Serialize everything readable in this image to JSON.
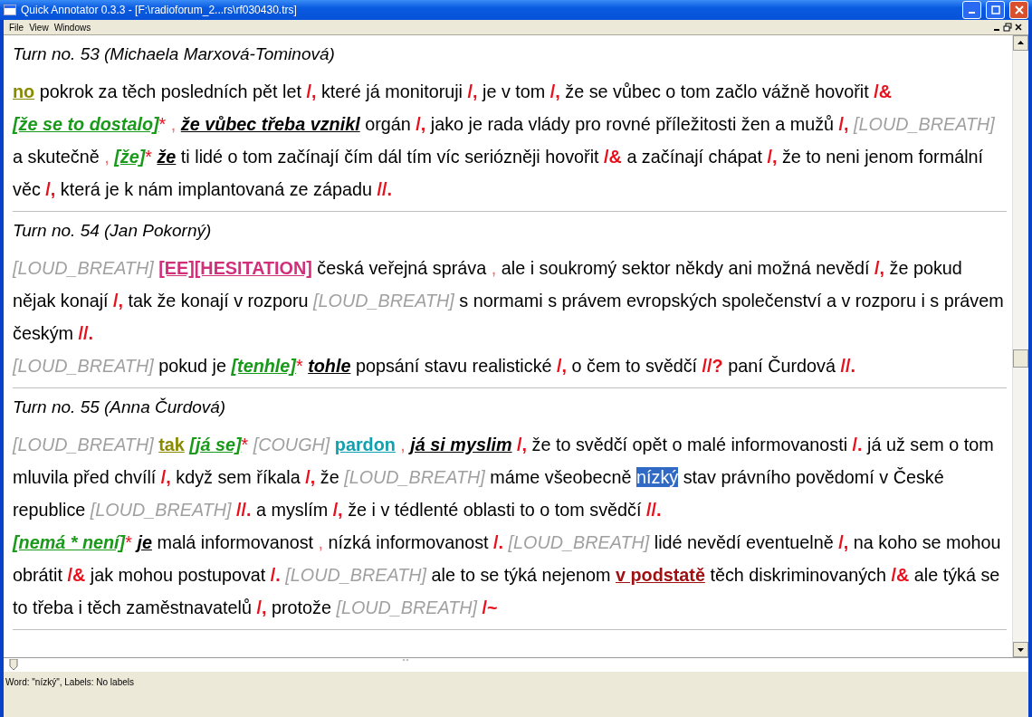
{
  "window": {
    "title": "Quick Annotator 0.3.3 - [F:\\radioforum_2...rs\\rf030430.trs]"
  },
  "menu": [
    "File",
    "View",
    "Windows"
  ],
  "turns": [
    {
      "title": "Turn no. 53 (Michaela Marxová-Tominová)",
      "paragraphs": [
        [
          {
            "kind": "olive",
            "text": "no"
          },
          {
            "kind": "plain",
            "text": "pokrok za těch posledních pět let"
          },
          {
            "kind": "mark",
            "text": "/,"
          },
          {
            "kind": "plain",
            "text": "které já monitoruji"
          },
          {
            "kind": "mark",
            "text": "/,"
          },
          {
            "kind": "plain",
            "text": "je v tom"
          },
          {
            "kind": "mark",
            "text": "/,"
          },
          {
            "kind": "plain",
            "text": "že se vůbec o tom začlo vážně hovořit"
          },
          {
            "kind": "mark",
            "text": "/&"
          },
          {
            "kind": "correction",
            "text": "[že se to dostalo]"
          },
          {
            "kind": "star",
            "text": "*"
          },
          {
            "kind": "soft",
            "text": ","
          },
          {
            "kind": "emph",
            "text": "že vůbec třeba vznikl"
          },
          {
            "kind": "plain",
            "text": "orgán"
          },
          {
            "kind": "mark",
            "text": "/,"
          },
          {
            "kind": "plain",
            "text": "jako je rada vlády pro rovné příležitosti žen a mužů"
          },
          {
            "kind": "mark",
            "text": "/,"
          },
          {
            "kind": "noise",
            "text": "[LOUD_BREATH]"
          },
          {
            "kind": "plain",
            "text": "a skutečně"
          },
          {
            "kind": "soft",
            "text": ","
          },
          {
            "kind": "correction",
            "text": "[že]"
          },
          {
            "kind": "star",
            "text": "*"
          },
          {
            "kind": "emph",
            "text": "že"
          },
          {
            "kind": "plain",
            "text": "ti lidé o tom začínají čím dál tím víc seriózněji hovořit"
          },
          {
            "kind": "mark",
            "text": "/&"
          },
          {
            "kind": "plain",
            "text": "a začínají chápat"
          },
          {
            "kind": "mark",
            "text": "/,"
          },
          {
            "kind": "plain",
            "text": "že to neni jenom formální věc"
          },
          {
            "kind": "mark",
            "text": "/,"
          },
          {
            "kind": "plain",
            "text": "která je k nám implantovaná ze západu"
          },
          {
            "kind": "mark",
            "text": "//."
          }
        ]
      ]
    },
    {
      "title": "Turn no. 54 (Jan Pokorný)",
      "paragraphs": [
        [
          {
            "kind": "noise",
            "text": "[LOUD_BREATH]"
          },
          {
            "kind": "hesitation",
            "text": "[EE][HESITATION]"
          },
          {
            "kind": "plain",
            "text": "česká veřejná správa"
          },
          {
            "kind": "soft",
            "text": ","
          },
          {
            "kind": "plain",
            "text": "ale i soukromý sektor někdy ani možná nevědí"
          },
          {
            "kind": "mark",
            "text": "/,"
          },
          {
            "kind": "plain",
            "text": "že pokud nějak konají"
          },
          {
            "kind": "mark",
            "text": "/,"
          },
          {
            "kind": "plain",
            "text": "tak že konají v rozporu"
          },
          {
            "kind": "noise",
            "text": "[LOUD_BREATH]"
          },
          {
            "kind": "plain",
            "text": "s normami s právem evropských společenství a v rozporu i s právem českým"
          },
          {
            "kind": "mark",
            "text": "//."
          }
        ],
        [
          {
            "kind": "noise",
            "text": "[LOUD_BREATH]"
          },
          {
            "kind": "plain",
            "text": "pokud je"
          },
          {
            "kind": "correction",
            "text": "[tenhle]"
          },
          {
            "kind": "star",
            "text": "*"
          },
          {
            "kind": "emph",
            "text": "tohle"
          },
          {
            "kind": "plain",
            "text": "popsání stavu realistické"
          },
          {
            "kind": "mark",
            "text": "/,"
          },
          {
            "kind": "plain",
            "text": "o čem to svědčí"
          },
          {
            "kind": "mark",
            "text": "//?"
          },
          {
            "kind": "plain",
            "text": "paní Čurdová"
          },
          {
            "kind": "mark",
            "text": "//."
          }
        ]
      ]
    },
    {
      "title": "Turn no. 55 (Anna Čurdová)",
      "paragraphs": [
        [
          {
            "kind": "noise",
            "text": "[LOUD_BREATH]"
          },
          {
            "kind": "olive",
            "text": "tak"
          },
          {
            "kind": "correction",
            "text": "[já se]"
          },
          {
            "kind": "star",
            "text": "*"
          },
          {
            "kind": "noise",
            "text": "[COUGH]"
          },
          {
            "kind": "teal",
            "text": "pardon"
          },
          {
            "kind": "soft",
            "text": ","
          },
          {
            "kind": "emph",
            "text": "já si myslim"
          },
          {
            "kind": "mark",
            "text": "/,"
          },
          {
            "kind": "plain",
            "text": "že to svědčí opět o malé informovanosti"
          },
          {
            "kind": "mark",
            "text": "/."
          },
          {
            "kind": "plain",
            "text": "já už sem o tom mluvila před chvílí"
          },
          {
            "kind": "mark",
            "text": "/,"
          },
          {
            "kind": "plain",
            "text": "když sem říkala"
          },
          {
            "kind": "mark",
            "text": "/,"
          },
          {
            "kind": "plain",
            "text": "že"
          },
          {
            "kind": "noise",
            "text": "[LOUD_BREATH]"
          },
          {
            "kind": "plain",
            "text": "máme všeobecně"
          },
          {
            "kind": "highlight",
            "text": "nízký"
          },
          {
            "kind": "plain",
            "text": "stav právního povědomí v České republice"
          },
          {
            "kind": "noise",
            "text": "[LOUD_BREATH]"
          },
          {
            "kind": "mark",
            "text": "//."
          },
          {
            "kind": "plain",
            "text": "a myslím"
          },
          {
            "kind": "mark",
            "text": "/,"
          },
          {
            "kind": "plain",
            "text": "že i v tédlenté oblasti to o tom svědčí"
          },
          {
            "kind": "mark",
            "text": "//."
          }
        ],
        [
          {
            "kind": "correction",
            "text": "[nemá * není]"
          },
          {
            "kind": "star",
            "text": "*"
          },
          {
            "kind": "emph",
            "text": "je"
          },
          {
            "kind": "plain",
            "text": "malá informovanost"
          },
          {
            "kind": "soft",
            "text": ","
          },
          {
            "kind": "plain",
            "text": "nízká informovanost"
          },
          {
            "kind": "mark",
            "text": "/."
          },
          {
            "kind": "noise",
            "text": "[LOUD_BREATH]"
          },
          {
            "kind": "plain",
            "text": "lidé nevědí eventuelně"
          },
          {
            "kind": "mark",
            "text": "/,"
          },
          {
            "kind": "plain",
            "text": "na koho se mohou obrátit"
          },
          {
            "kind": "mark",
            "text": "/&"
          },
          {
            "kind": "plain",
            "text": "jak mohou postupovat"
          },
          {
            "kind": "mark",
            "text": "/."
          },
          {
            "kind": "noise",
            "text": "[LOUD_BREATH]"
          },
          {
            "kind": "plain",
            "text": "ale to se týká nejenom"
          },
          {
            "kind": "darkred",
            "text": "v podstatě"
          },
          {
            "kind": "plain",
            "text": "těch diskriminovaných"
          },
          {
            "kind": "mark",
            "text": "/&"
          },
          {
            "kind": "plain",
            "text": "ale týká se to třeba i těch zaměstnavatelů"
          },
          {
            "kind": "mark",
            "text": "/,"
          },
          {
            "kind": "plain",
            "text": "protože"
          },
          {
            "kind": "noise",
            "text": "[LOUD_BREATH]"
          },
          {
            "kind": "mark",
            "text": "/~"
          }
        ]
      ]
    }
  ],
  "position_slider": {
    "level": 0
  },
  "status_bar": "Word: \"nízký\", Labels: No labels"
}
